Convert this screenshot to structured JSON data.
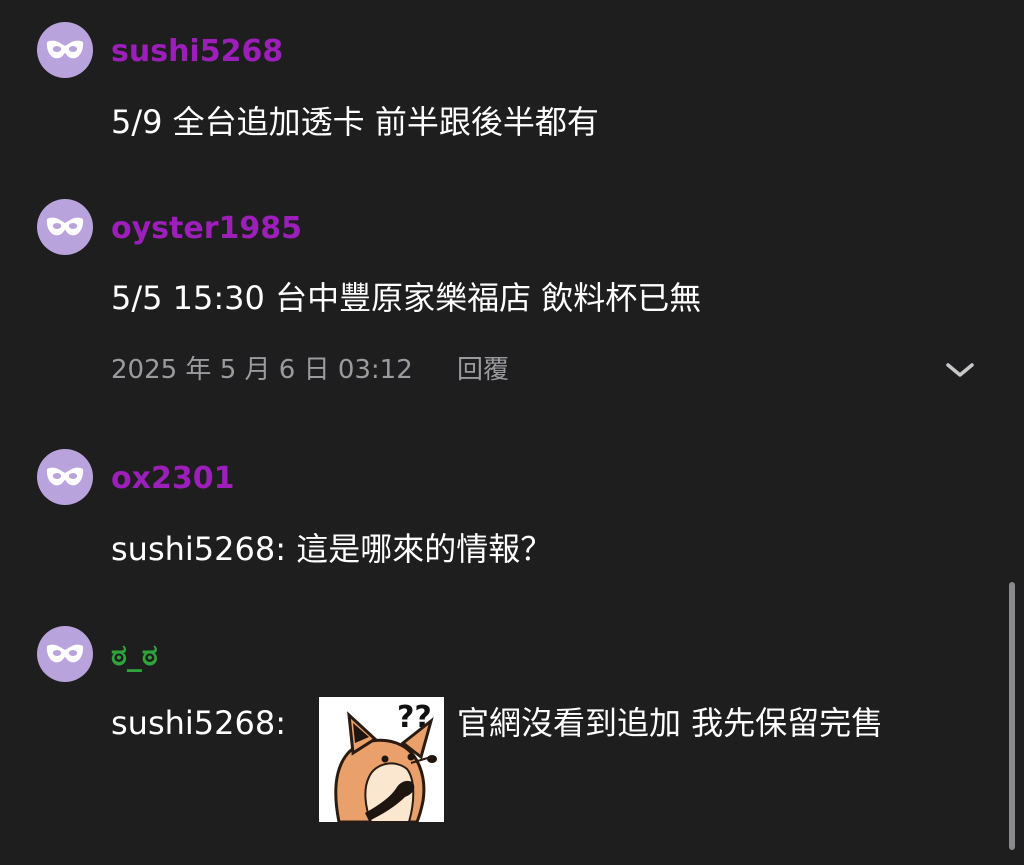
{
  "comments": [
    {
      "username": "sushi5268",
      "username_color": "#9b1fb8",
      "avatar_icon": "mask-icon",
      "message": "5/9 全台追加透卡 前半跟後半都有"
    },
    {
      "username": "oyster1985",
      "username_color": "#9b1fb8",
      "avatar_icon": "mask-icon",
      "message": "5/5 15:30 台中豐原家樂福店 飲料杯已無",
      "timestamp": "2025 年 5 月 6 日 03:12",
      "reply_label": "回覆",
      "more_icon": "chevron-down-icon"
    },
    {
      "username": "ox2301",
      "username_color": "#9b1fb8",
      "avatar_icon": "mask-icon",
      "message": "sushi5268: 這是哪來的情報？"
    },
    {
      "username": "ಠ_ಠ",
      "username_color": "#2fa43a",
      "avatar_icon": "mask-icon",
      "message_prefix": "sushi5268:",
      "sticker_icon": "confused-fox-sticker",
      "message_suffix": "官網沒看到追加 我先保留完售"
    }
  ],
  "colors": {
    "background": "#1e1e1f",
    "avatar_bg": "#b9a3dd",
    "meta_text": "#9b9b9f"
  }
}
